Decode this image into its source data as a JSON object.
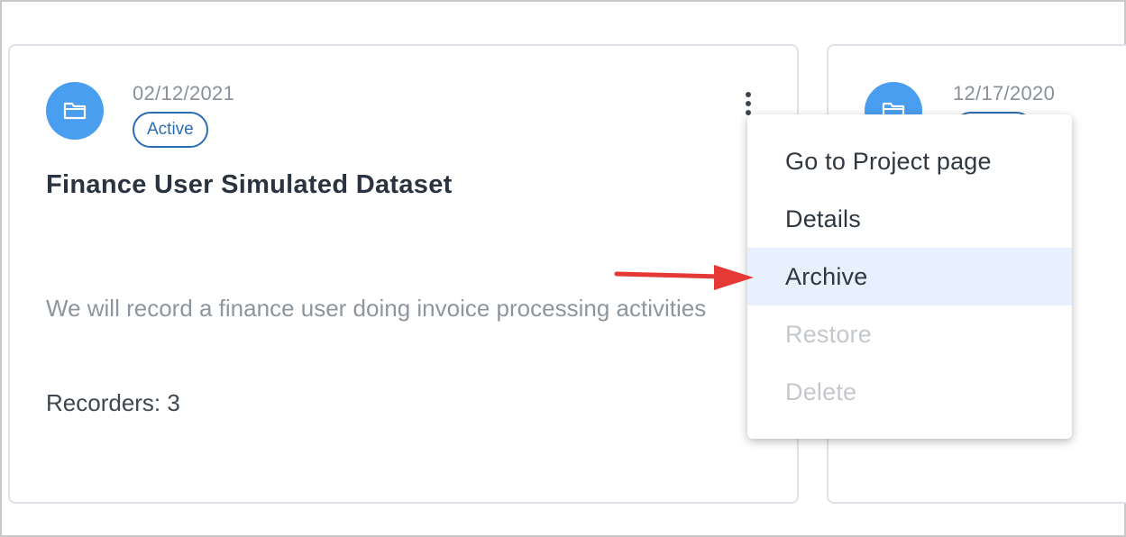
{
  "cards": [
    {
      "date": "02/12/2021",
      "status": "Active",
      "title": "Finance User Simulated Dataset",
      "description": "We will record a finance user doing invoice processing activities",
      "recorders": "Recorders: 3"
    },
    {
      "date": "12/17/2020"
    }
  ],
  "menu": {
    "items": [
      {
        "label": "Go to Project page",
        "state": "enabled"
      },
      {
        "label": "Details",
        "state": "enabled"
      },
      {
        "label": "Archive",
        "state": "highlighted"
      },
      {
        "label": "Restore",
        "state": "disabled"
      },
      {
        "label": "Delete",
        "state": "disabled"
      }
    ]
  },
  "icons": {
    "project_icon": "folder-icon",
    "more_icon": "kebab-menu-icon",
    "annotation": "red-arrow-icon"
  },
  "colors": {
    "accent": "#4a9eef",
    "badge": "#2a6db5",
    "highlight": "#e7f1fd",
    "annotation_arrow": "#e53935"
  }
}
